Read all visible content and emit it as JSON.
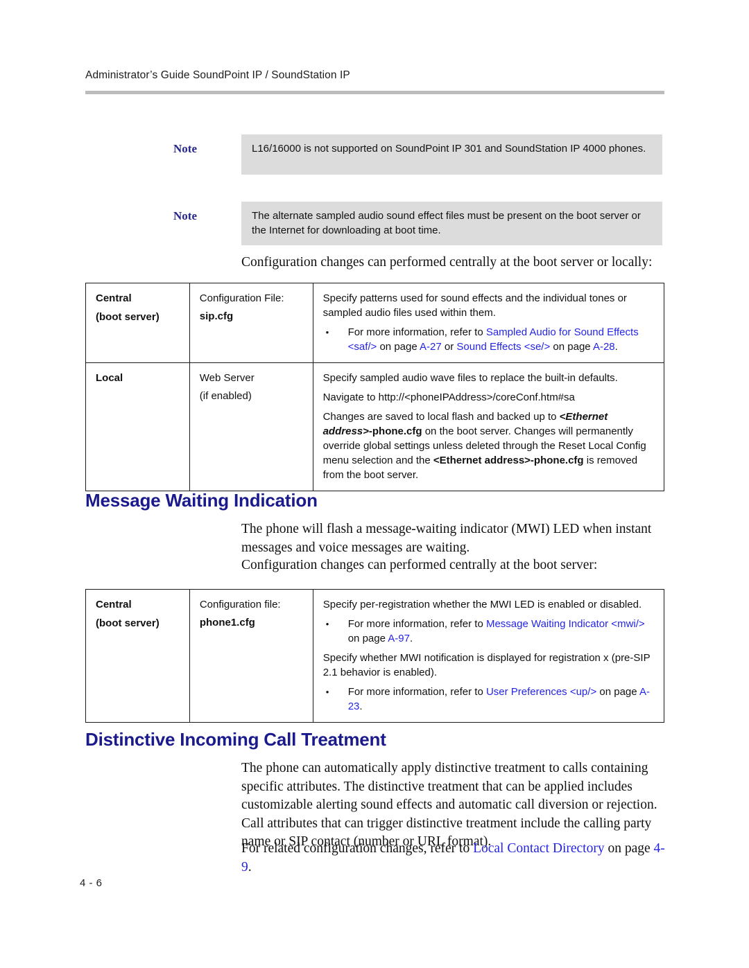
{
  "header": {
    "running_title": "Administrator’s Guide SoundPoint IP / SoundStation IP"
  },
  "footer": {
    "page_number": "4 - 6"
  },
  "colors": {
    "heading_blue": "#1a1a8c",
    "link_blue": "#2424e6",
    "note_label_blue": "#26268c",
    "note_background": "#dcdcdc",
    "rule_gray": "#bcbcbc"
  },
  "notes": [
    {
      "label": "Note",
      "text": "L16/16000 is not supported on SoundPoint IP 301 and SoundStation IP 4000 phones."
    },
    {
      "label": "Note",
      "text": "The alternate sampled audio sound effect files must be present on the boot server or the Internet for downloading at boot time."
    }
  ],
  "intro_paragraph": "Configuration changes can performed centrally at the boot server or locally:",
  "table_sound_effects": {
    "rows": [
      {
        "scope_line1": "Central",
        "scope_line2": "(boot server)",
        "file_line1": "Configuration File:",
        "file_line2": "sip.cfg",
        "desc_p1": "Specify patterns used for sound effects and the individual tones or sampled audio files used within them.",
        "bullet1_pre": "For more information, refer to ",
        "bullet1_link1": "Sampled Audio for Sound Effects <saf/>",
        "bullet1_mid1": " on page ",
        "bullet1_link2": "A-27",
        "bullet1_mid2": " or ",
        "bullet1_link3": "Sound Effects <se/>",
        "bullet1_mid3": " on page ",
        "bullet1_link4": "A-28",
        "bullet1_end": "."
      },
      {
        "scope_line1": "Local",
        "file_line1": "Web Server",
        "file_line2": "(if enabled)",
        "desc_p1": "Specify sampled audio wave files to replace the built-in defaults.",
        "desc_p2": "Navigate to http://<phoneIPAddress>/coreConf.htm#sa",
        "desc_p3_pre": "Changes are saved to local flash and backed up to ",
        "desc_p3_bi": "<Ethernet address>",
        "desc_p3_b": "-phone.cfg",
        "desc_p3_mid": " on the boot server. Changes will permanently override global settings unless deleted through the Reset Local Config menu selection and the ",
        "desc_p3_b2": "<Ethernet address>-phone.cfg",
        "desc_p3_end": " is removed from the boot server."
      }
    ]
  },
  "section_mwi": {
    "heading": "Message Waiting Indication",
    "paragraph1": "The phone will flash a message-waiting indicator (MWI) LED when instant messages and voice messages are waiting.",
    "paragraph2": "Configuration changes can performed centrally at the boot server:",
    "table": {
      "rows": [
        {
          "scope_line1": "Central",
          "scope_line2": "(boot server)",
          "file_line1": "Configuration file:",
          "file_line2": "phone1.cfg",
          "desc_p1": "Specify per-registration whether the MWI LED is enabled or disabled.",
          "bullet1_pre": "For more information, refer to ",
          "bullet1_link1": "Message Waiting Indicator <mwi/>",
          "bullet1_mid1": " on page ",
          "bullet1_link2": "A-97",
          "bullet1_end": ".",
          "desc_p2": "Specify whether MWI notification is displayed for registration x (pre-SIP 2.1 behavior is enabled).",
          "bullet2_pre": "For more information, refer to ",
          "bullet2_link1": "User Preferences <up/>",
          "bullet2_mid1": " on page ",
          "bullet2_link2": "A-23",
          "bullet2_end": "."
        }
      ]
    }
  },
  "section_distinctive": {
    "heading": "Distinctive Incoming Call Treatment",
    "paragraph1": "The phone can automatically apply distinctive treatment to calls containing specific attributes. The distinctive treatment that can be applied includes customizable alerting sound effects and automatic call diversion or rejection. Call attributes that can trigger distinctive treatment include the calling party name or SIP contact (number or URL format).",
    "paragraph2_pre": "For related configuration changes, refer to ",
    "paragraph2_link1": "Local Contact Directory",
    "paragraph2_mid": " on page ",
    "paragraph2_link2": "4-9",
    "paragraph2_end": "."
  }
}
